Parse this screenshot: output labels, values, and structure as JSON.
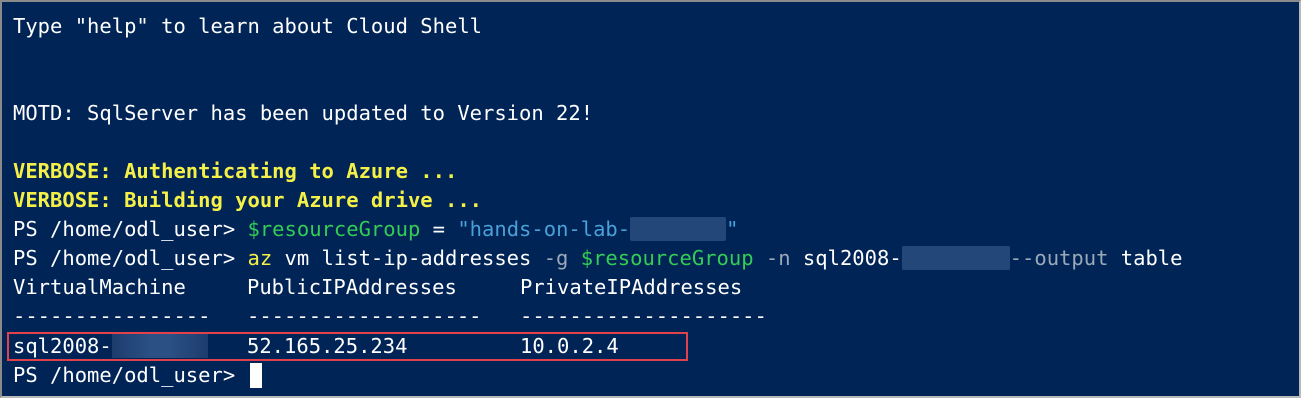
{
  "terminal": {
    "line_help": "Type \"help\" to learn about Cloud Shell",
    "line_motd": "MOTD: SqlServer has been updated to Version 22!",
    "line_verbose_1": "VERBOSE: Authenticating to Azure ...",
    "line_verbose_2": "VERBOSE: Building your Azure drive ...",
    "prompt": "PS /home/odl_user> ",
    "cmd1": {
      "variable": "$resourceGroup",
      "operator": " = ",
      "string_start": "\"hands-on-lab-",
      "string_end": "\""
    },
    "cmd2": {
      "az": "az",
      "args": " vm list-ip-addresses",
      "flag_g": " -g ",
      "variable": "$resourceGroup",
      "flag_n": " -n ",
      "vm_prefix": "sql2008-",
      "flag_output": "--output",
      "output_value": " table"
    },
    "table": {
      "headers": [
        "VirtualMachine",
        "PublicIPAddresses",
        "PrivateIPAddresses"
      ],
      "separators": [
        "----------------",
        "-------------------",
        "--------------------"
      ],
      "row": {
        "vm_prefix": "sql2008-",
        "public_ip": "52.165.25.234",
        "private_ip": "10.0.2.4"
      }
    },
    "highlight_color": "#e0414b",
    "background_color": "#012456"
  }
}
